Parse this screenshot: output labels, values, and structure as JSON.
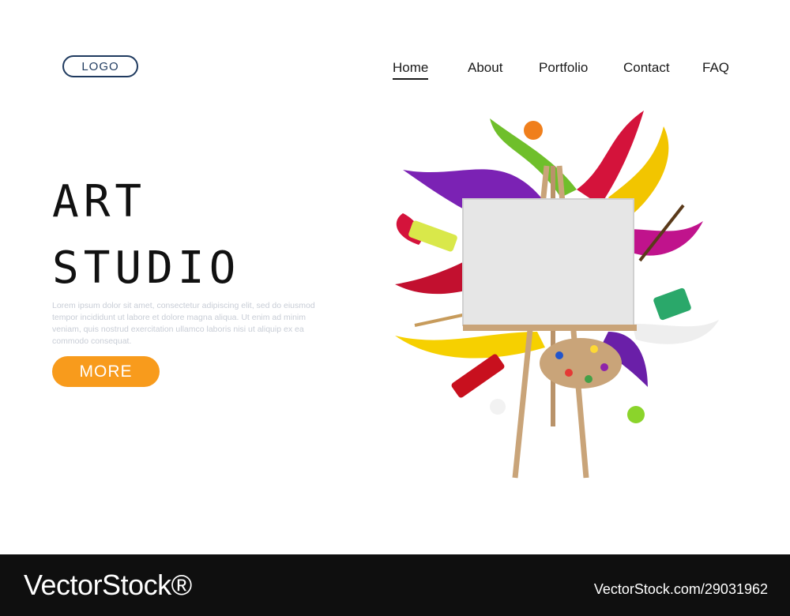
{
  "header": {
    "logo_label": "LOGO",
    "nav": {
      "home": "Home",
      "about": "About",
      "portfolio": "Portfolio",
      "contact": "Contact",
      "faq": "FAQ"
    },
    "active_nav": "Home"
  },
  "hero": {
    "title_line1": "ART",
    "title_line2": "STUDIO",
    "body": "Lorem ipsum dolor sit amet, consectetur adipiscing elit, sed do eiusmod tempor incididunt ut labore et dolore magna aliqua. Ut enim ad minim veniam, quis nostrud exercitation ullamco laboris nisi ut aliquip ex ea commodo consequat.",
    "more_button": "MORE"
  },
  "colors": {
    "accent": "#f89b1c",
    "logo_border": "#1f3a5f",
    "footer_bg": "#0f0f0f"
  },
  "watermark": {
    "brand": "VectorStock®",
    "url": "VectorStock.com/29031962"
  }
}
